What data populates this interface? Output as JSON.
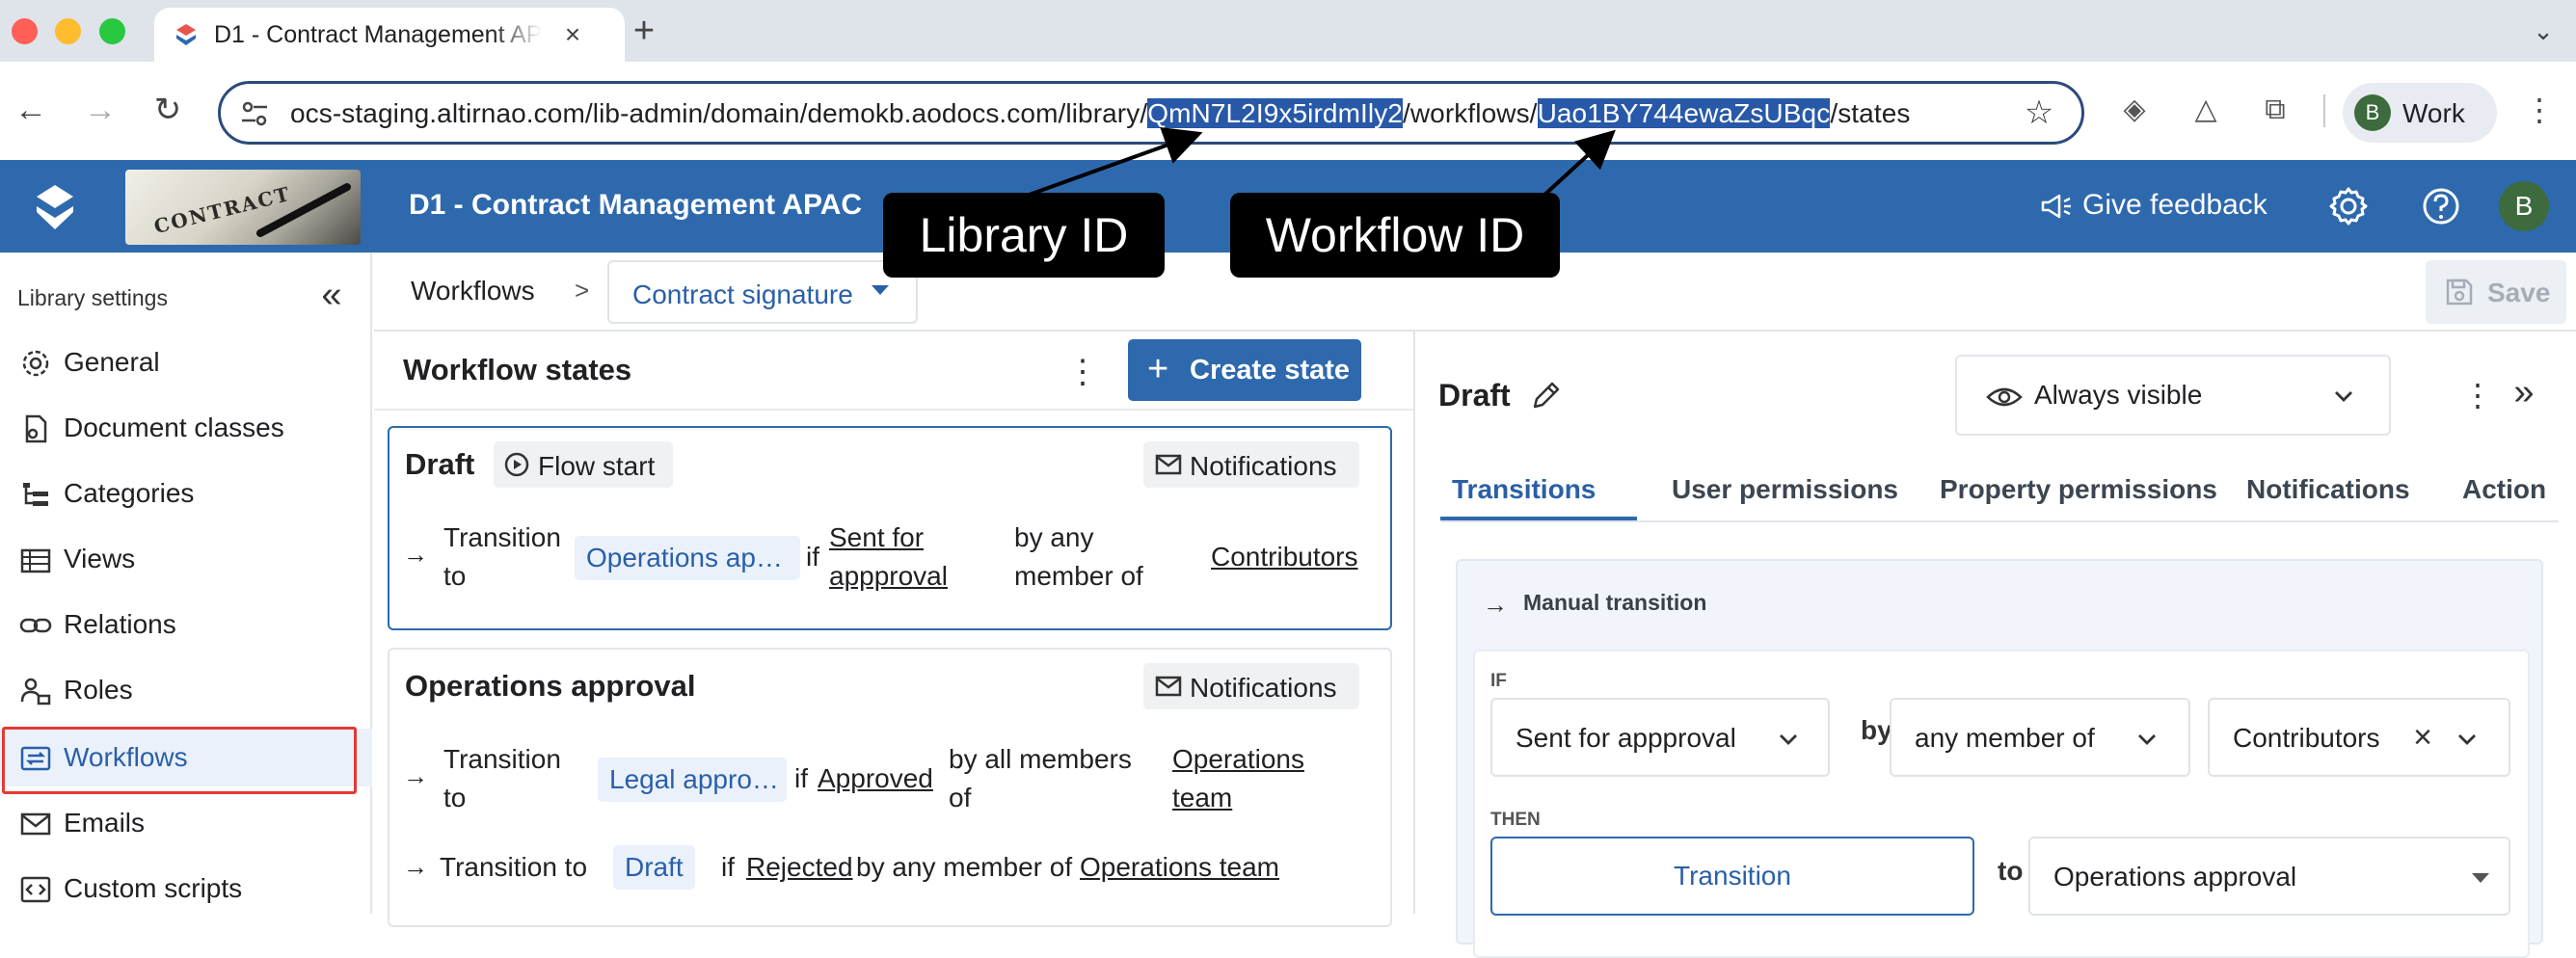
{
  "browser": {
    "tab_title": "D1 - Contract Management AP",
    "url_prefix": "ocs-staging.altirnao.com/lib-admin/domain/demokb.aodocs.com/library/",
    "url_library_id": "QmN7L2I9x5irdmIly2",
    "url_mid": "/workflows/",
    "url_workflow_id": "Uao1BY744ewaZsUBqc",
    "url_suffix": "/states",
    "profile_initial": "B",
    "profile_label": "Work"
  },
  "app": {
    "title": "D1 - Contract Management APAC",
    "banner_text": "CONTRACT",
    "feedback_label": "Give feedback",
    "user_initial": "B"
  },
  "callouts": {
    "library": "Library ID",
    "workflow": "Workflow ID"
  },
  "sidebar": {
    "header": "Library settings",
    "items": [
      {
        "label": "General",
        "icon": "gear-icon"
      },
      {
        "label": "Document classes",
        "icon": "document-classes-icon"
      },
      {
        "label": "Categories",
        "icon": "categories-icon"
      },
      {
        "label": "Views",
        "icon": "views-icon"
      },
      {
        "label": "Relations",
        "icon": "link-icon"
      },
      {
        "label": "Roles",
        "icon": "roles-icon"
      },
      {
        "label": "Workflows",
        "icon": "workflows-icon"
      },
      {
        "label": "Emails",
        "icon": "mail-icon"
      },
      {
        "label": "Custom scripts",
        "icon": "code-icon"
      }
    ],
    "active": "Workflows"
  },
  "breadcrumb": {
    "root": "Workflows",
    "separator": ">",
    "current": "Contract signature",
    "save_label": "Save"
  },
  "states": {
    "title": "Workflow states",
    "create_label": "Create state",
    "list": [
      {
        "name": "Draft",
        "flow_start": "Flow start",
        "notifications": "Notifications",
        "transition": {
          "to_label_1": "Transition",
          "to_label_2": "to",
          "target": "Operations ap…",
          "if": "if",
          "action_1": "Sent for",
          "action_2": "appproval",
          "by_1": "by any",
          "by_2": "member of",
          "group": "Contributors"
        }
      },
      {
        "name": "Operations approval",
        "notifications": "Notifications",
        "transition": {
          "to_label_1": "Transition",
          "to_label_2": "to",
          "target": "Legal appro…",
          "if": "if",
          "action": "Approved",
          "by_1": "by all members",
          "by_2": "of",
          "group_1": "Operations",
          "group_2": "team"
        },
        "transition2": {
          "to_label": "Transition to",
          "target": "Draft",
          "if": "if",
          "action": "Rejected",
          "by": "by any member of",
          "group": "Operations team"
        }
      }
    ]
  },
  "detail": {
    "title": "Draft",
    "visibility": "Always visible",
    "tabs": [
      "Transitions",
      "User permissions",
      "Property permissions",
      "Notifications",
      "Action"
    ],
    "active_tab": "Transitions",
    "manual_transition": {
      "header": "Manual transition",
      "if_label": "IF",
      "action": "Sent for appproval",
      "by_word": "by",
      "membership": "any member of",
      "group": "Contributors",
      "then_label": "THEN",
      "transition_label": "Transition",
      "to_word": "to",
      "target": "Operations approval"
    }
  },
  "colors": {
    "brand_blue": "#2e69ad",
    "link_blue": "#2a5fa8",
    "highlight_red": "#e53935"
  }
}
